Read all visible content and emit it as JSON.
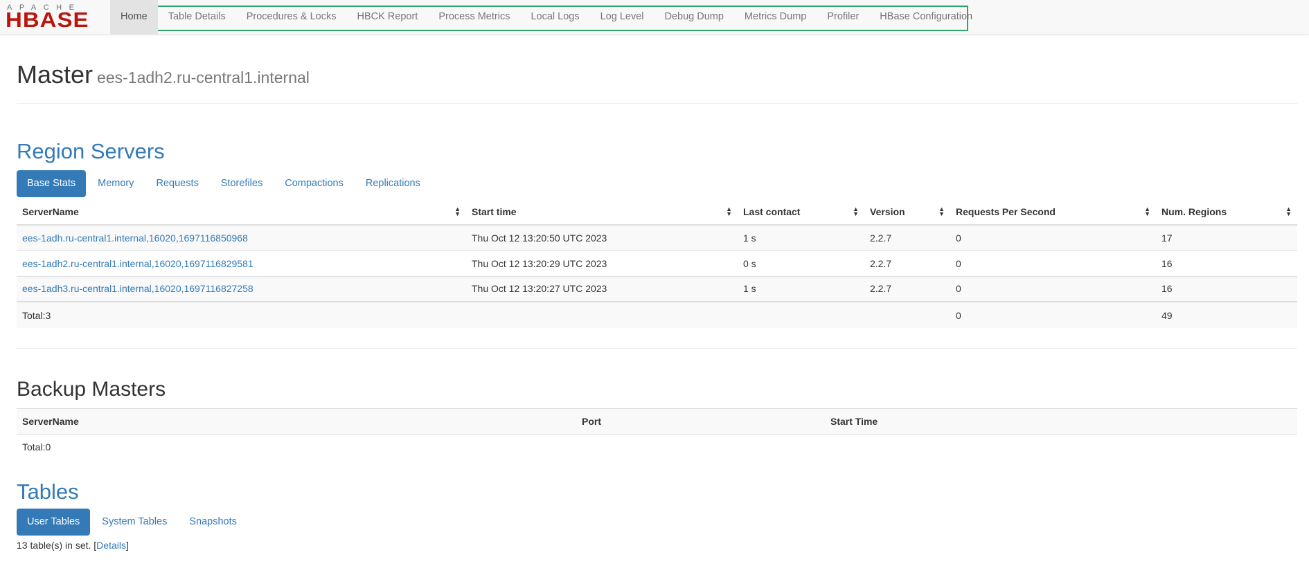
{
  "logo": {
    "apache_text": "APACHE",
    "hbase_text": "HBASE"
  },
  "nav": {
    "items": [
      {
        "label": "Home",
        "active": true
      },
      {
        "label": "Table Details"
      },
      {
        "label": "Procedures & Locks"
      },
      {
        "label": "HBCK Report"
      },
      {
        "label": "Process Metrics"
      },
      {
        "label": "Local Logs"
      },
      {
        "label": "Log Level"
      },
      {
        "label": "Debug Dump"
      },
      {
        "label": "Metrics Dump"
      },
      {
        "label": "Profiler"
      },
      {
        "label": "HBase Configuration"
      }
    ]
  },
  "header": {
    "title": "Master",
    "subtitle": "ees-1adh2.ru-central1.internal"
  },
  "region_servers": {
    "title": "Region Servers",
    "tabs": [
      {
        "label": "Base Stats",
        "active": true
      },
      {
        "label": "Memory"
      },
      {
        "label": "Requests"
      },
      {
        "label": "Storefiles"
      },
      {
        "label": "Compactions"
      },
      {
        "label": "Replications"
      }
    ],
    "columns": [
      "ServerName",
      "Start time",
      "Last contact",
      "Version",
      "Requests Per Second",
      "Num. Regions"
    ],
    "rows": [
      [
        "ees-1adh.ru-central1.internal,16020,1697116850968",
        "Thu Oct 12 13:20:50 UTC 2023",
        "1 s",
        "2.2.7",
        "0",
        "17"
      ],
      [
        "ees-1adh2.ru-central1.internal,16020,1697116829581",
        "Thu Oct 12 13:20:29 UTC 2023",
        "0 s",
        "2.2.7",
        "0",
        "16"
      ],
      [
        "ees-1adh3.ru-central1.internal,16020,1697116827258",
        "Thu Oct 12 13:20:27 UTC 2023",
        "1 s",
        "2.2.7",
        "0",
        "16"
      ]
    ],
    "total": {
      "label": "Total:3",
      "requests": "0",
      "regions": "49"
    }
  },
  "backup_masters": {
    "title": "Backup Masters",
    "columns": [
      "ServerName",
      "Port",
      "Start Time"
    ],
    "total": "Total:0"
  },
  "tables": {
    "title": "Tables",
    "tabs": [
      {
        "label": "User Tables",
        "active": true
      },
      {
        "label": "System Tables"
      },
      {
        "label": "Snapshots"
      }
    ],
    "info_prefix": "13 table(s) in set. [",
    "details_label": "Details",
    "info_suffix": "]"
  },
  "icons": {
    "sort": "sort-icon"
  },
  "colors": {
    "link": "#337ab7",
    "nav_highlight": "#2ea66b",
    "logo_red": "#ba160c"
  }
}
